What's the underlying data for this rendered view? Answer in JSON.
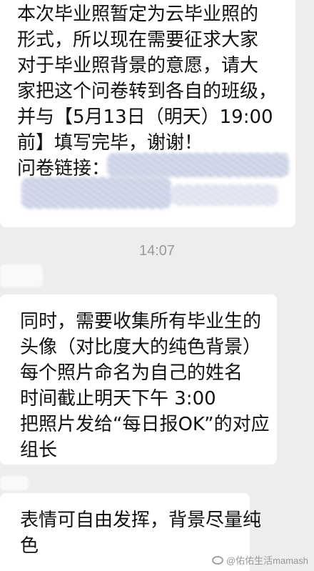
{
  "messages": [
    {
      "lines": [
        "本次毕业照暂定为云毕业照的",
        "形式，所以现在需要征求大家",
        "对于毕业照背景的意愿，请大",
        "家把这个问卷转到各自的班级，",
        "并与【5月13日（明天）19:00",
        "前】填写完毕，谢谢！",
        "问卷链接："
      ]
    },
    {
      "lines": [
        "同时，需要收集所有毕业生的",
        "头像（对比度大的纯色背景）",
        "每个照片命名为自己的姓名",
        "时间截止明天下午 3:00",
        "把照片发给“每日报OK”的对应",
        "组长"
      ]
    },
    {
      "lines": [
        "表情可自由发挥，背景尽量纯",
        "色"
      ]
    }
  ],
  "timestamp": "14:07",
  "watermark": {
    "text": "@佑佑生活mamash",
    "icon": "weibo-icon"
  }
}
